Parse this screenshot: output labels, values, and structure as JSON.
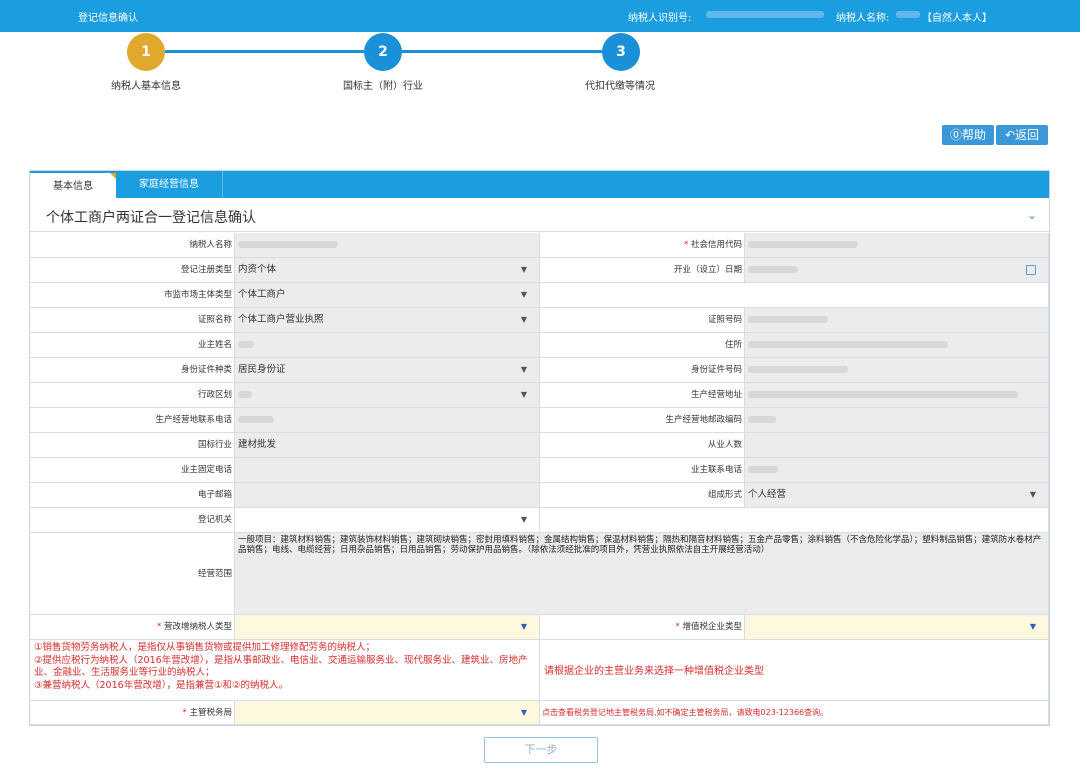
{
  "header": {
    "title": "登记信息确认",
    "taxpayer_id_label": "纳税人识别号:",
    "taxpayer_name_label": "纳税人名称:",
    "taxpayer_type": "【自然人本人】"
  },
  "steps": [
    {
      "num": "1",
      "label": "纳税人基本信息"
    },
    {
      "num": "2",
      "label": "国标主（附）行业"
    },
    {
      "num": "3",
      "label": "代扣代缴等情况"
    }
  ],
  "actions": {
    "help": "帮助",
    "back": "返回",
    "next": "下一步"
  },
  "tabs": [
    "基本信息",
    "家庭经营信息"
  ],
  "section_title": "个体工商户两证合一登记信息确认",
  "form": {
    "taxpayer_name": "纳税人名称",
    "credit_code": "社会信用代码",
    "reg_type_label": "登记注册类型",
    "reg_type_value": "内资个体",
    "open_date": "开业（设立）日期",
    "market_type_label": "市监市场主体类型",
    "market_type_value": "个体工商户",
    "cert_name_label": "证照名称",
    "cert_name_value": "个体工商户营业执照",
    "cert_no": "证照号码",
    "owner_name": "业主姓名",
    "residence": "住所",
    "id_type_label": "身份证件种类",
    "id_type_value": "居民身份证",
    "id_no": "身份证件号码",
    "region": "行政区划",
    "biz_address": "生产经营地址",
    "biz_phone": "生产经营地联系电话",
    "biz_postcode": "生产经营地邮政编码",
    "industry_label": "国标行业",
    "industry_value": "建材批发",
    "employees": "从业人数",
    "owner_fixed_phone": "业主固定电话",
    "owner_contact_phone": "业主联系电话",
    "email": "电子邮箱",
    "org_form_label": "组成形式",
    "org_form_value": "个人经营",
    "reg_authority": "登记机关",
    "scope_label": "经营范围",
    "scope_value": "一般项目：建筑材料销售；建筑装饰材料销售；建筑砌块销售；密封用填料销售；金属结构销售；保温材料销售；隔热和隔音材料销售；五金产品零售；涂料销售（不含危险化学品）；塑料制品销售；建筑防水卷材产品销售；电线、电缆经营；日用杂品销售；日用品销售；劳动保护用品销售。（除依法须经批准的项目外，凭营业执照依法自主开展经营活动）",
    "vat_taxpayer_type": "营改增纳税人类型",
    "vat_enterprise_type": "增值税企业类型",
    "notes": [
      "①销售货物劳务纳税人，是指仅从事销售货物或提供加工修理修配劳务的纳税人；",
      "②提供应税行为纳税人（2016年营改增），是指从事邮政业、电信业、交通运输服务业、现代服务业、建筑业、房地产业、金融业、生活服务业等行业的纳税人；",
      "③兼营纳税人（2016年营改增），是指兼营①和②的纳税人。"
    ],
    "vat_hint": "请根据企业的主营业务来选择一种增值税企业类型",
    "tax_bureau": "主管税务局",
    "tax_bureau_hint": "点击查看税务登记地主管税务局,如不确定主管税务局，请致电023-12366查询。"
  },
  "colors": {
    "primary": "#1a9ee0",
    "step_active": "#e0a82c",
    "required": "#d82b2b"
  }
}
